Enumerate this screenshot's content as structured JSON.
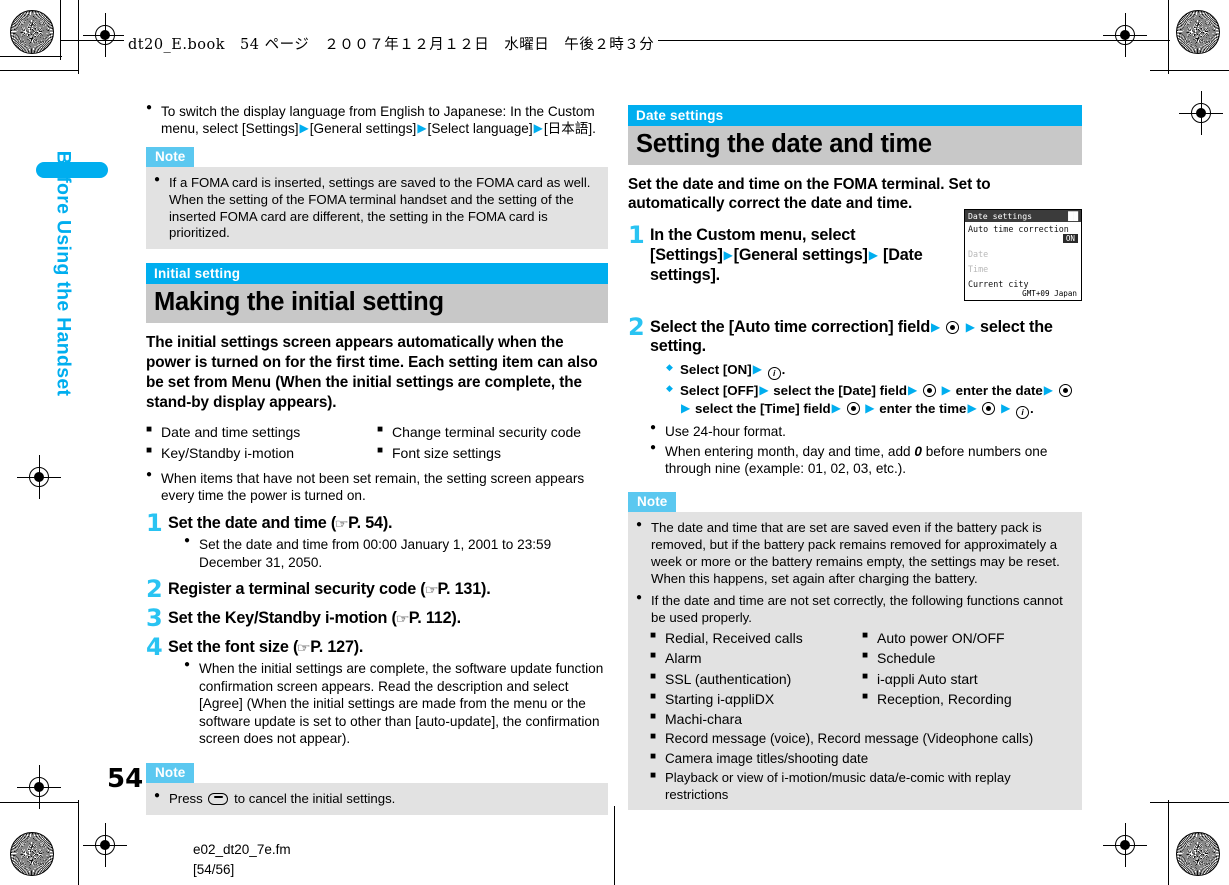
{
  "header": {
    "print_info": "dt20_E.book　54 ページ　２００７年１２月１２日　水曜日　午後２時３分"
  },
  "sidebar": {
    "chapter_title": "Before Using the Handset"
  },
  "footer": {
    "page_number": "54",
    "file_name": "e02_dt20_7e.fm",
    "file_pages": "[54/56]"
  },
  "colors": {
    "accent_blue": "#00AEEF",
    "note_tag": "#5BC8F0",
    "banner_gray": "#C8C8C8",
    "note_body": "#E2E2E2",
    "step_number": "#29C3F2"
  },
  "left_column": {
    "top_bullet": {
      "text_a": "To switch the display language from English to Japanese: In the Custom menu, select [Settings]",
      "text_b": "[General settings]",
      "text_c": "[Select language]",
      "text_d": "[日本語]."
    },
    "note_top": {
      "tag": "Note",
      "items": [
        "If a FOMA card is inserted, settings are saved to the FOMA card as well. When the setting of the FOMA terminal handset and the setting of the inserted FOMA card are different, the setting in the FOMA card is prioritized."
      ]
    },
    "section": {
      "eyebrow": "Initial setting",
      "title": "Making the initial setting",
      "lead": "The initial settings screen appears automatically when the power is turned on for the first time. Each setting item can also be set from Menu (When the initial settings are complete, the stand-by display appears)."
    },
    "feature_list": [
      "Date and time settings",
      "Change terminal security code",
      "Key/Standby i-motion",
      "Font size settings"
    ],
    "after_list_bullet": "When items that have not been set remain, the setting screen appears every time the power is turned on.",
    "steps": [
      {
        "num": "1",
        "title_a": "Set the date and time (",
        "title_b": "P. 54).",
        "bullets": [
          "Set the date and time from 00:00 January 1, 2001 to 23:59 December 31, 2050."
        ]
      },
      {
        "num": "2",
        "title_a": "Register a terminal security code (",
        "title_b": "P. 131).",
        "bullets": []
      },
      {
        "num": "3",
        "title_a": "Set the Key/Standby i-motion (",
        "title_b": "P. 112).",
        "bullets": []
      },
      {
        "num": "4",
        "title_a": "Set the font size (",
        "title_b": "P. 127).",
        "bullets": [
          "When the initial settings are complete, the software update function confirmation screen appears. Read the description and select [Agree] (When the initial settings are made from the menu or the software update is set to other than [auto-update], the confirmation screen does not appear)."
        ]
      }
    ],
    "note_bottom": {
      "tag": "Note",
      "item_a": "Press",
      "item_b": "to cancel the initial settings."
    }
  },
  "right_column": {
    "section": {
      "eyebrow": "Date settings",
      "title": "Setting the date and time",
      "lead": "Set the date and time on the FOMA terminal. Set to automatically correct the date and time."
    },
    "screenshot": {
      "title": "Date settings",
      "battery_icon": "signal-icon",
      "line_auto": "Auto time correction",
      "value_on": "ON",
      "line_date": "Date",
      "line_time": "Time",
      "line_city": "Current city",
      "value_city": "GMT+09 Japan"
    },
    "step1": {
      "num": "1",
      "text_a": "In the Custom menu, select [Settings]",
      "text_b": "[General settings]",
      "text_c": "[Date settings]."
    },
    "step2": {
      "num": "2",
      "text_a": "Select the [Auto time correction] field",
      "text_b": "select the setting.",
      "diamonds": {
        "d1_a": "Select [ON]",
        "d1_b": ".",
        "d2_a": "Select [OFF]",
        "d2_b": "select the [Date] field",
        "d2_c": "enter the date",
        "d2_d": "select the [Time] field",
        "d2_e": "enter the time",
        "d2_f": "."
      },
      "bullets": [
        "Use 24-hour format.",
        "When entering month, day and time, add 0 before numbers one through nine (example: 01, 02, 03, etc.)."
      ],
      "bullet2_a": "When entering month, day and time, add",
      "bullet2_zero": "0",
      "bullet2_b": "before numbers one through nine (example: 01, 02, 03, etc.)."
    },
    "note": {
      "tag": "Note",
      "item1": "The date and time that are set are saved even if the battery pack is removed, but if the battery pack remains removed for approximately a week or more or the battery remains empty, the settings may be reset. When this happens, set again after charging the battery.",
      "item2": "If the date and time are not set correctly, the following functions cannot be used properly.",
      "functions_two_col": [
        "Redial, Received calls",
        "Auto power ON/OFF",
        "Alarm",
        "Schedule",
        "SSL (authentication)",
        "i-αppli Auto start",
        "Starting i-αppliDX",
        "Reception, Recording"
      ],
      "functions_full": [
        "Machi-chara",
        "Record message (voice), Record message (Videophone calls)",
        "Camera image titles/shooting date",
        "Playback or view of i-motion/music data/e-comic with replay restrictions"
      ]
    }
  }
}
